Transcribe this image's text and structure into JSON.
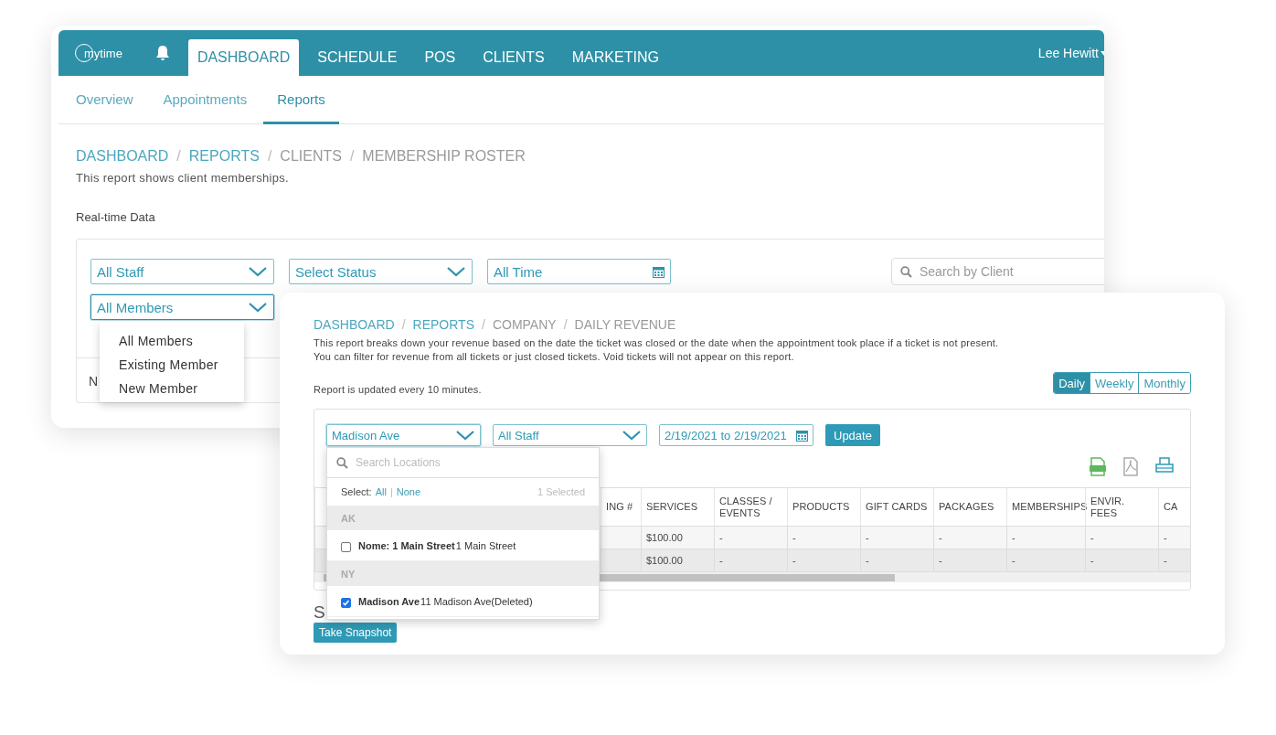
{
  "back_window": {
    "nav": {
      "logo": "mytime",
      "tabs": [
        {
          "label": "DASHBOARD",
          "selected": true
        },
        {
          "label": "SCHEDULE",
          "selected": false
        },
        {
          "label": "POS",
          "selected": false
        },
        {
          "label": "CLIENTS",
          "selected": false
        },
        {
          "label": "MARKETING",
          "selected": false
        }
      ],
      "user": "Lee Hewitt"
    },
    "subnav": [
      {
        "label": "Overview",
        "selected": false
      },
      {
        "label": "Appointments",
        "selected": false
      },
      {
        "label": "Reports",
        "selected": true
      }
    ],
    "breadcrumb": [
      {
        "label": "DASHBOARD",
        "kind": "link"
      },
      {
        "label": "/",
        "kind": "separator"
      },
      {
        "label": "REPORTS",
        "kind": "link"
      },
      {
        "label": "/",
        "kind": "separator"
      },
      {
        "label": "CLIENTS",
        "kind": "text"
      },
      {
        "label": "/",
        "kind": "separator"
      },
      {
        "label": "MEMBERSHIP ROSTER",
        "kind": "text"
      }
    ],
    "description": "This report shows client memberships.",
    "section_title": "Real-time Data",
    "filters": [
      {
        "kind": "select",
        "value": "All Staff"
      },
      {
        "kind": "select",
        "value": "Select Status"
      },
      {
        "kind": "date",
        "value": "All Time"
      }
    ],
    "search": {
      "placeholder": "Search by Client"
    },
    "member_filter": {
      "value": "All Members",
      "expanded": true,
      "options": [
        "All Members",
        "Existing Member",
        "New Member"
      ]
    },
    "footer_text": "N"
  },
  "front_window": {
    "breadcrumb": [
      {
        "label": "DASHBOARD",
        "kind": "link"
      },
      {
        "label": "/",
        "kind": "separator"
      },
      {
        "label": "REPORTS",
        "kind": "link"
      },
      {
        "label": "/",
        "kind": "separator"
      },
      {
        "label": "COMPANY",
        "kind": "text"
      },
      {
        "label": "/",
        "kind": "separator"
      },
      {
        "label": "DAILY REVENUE",
        "kind": "text"
      }
    ],
    "description": "This report breaks down your revenue based on the date the ticket was closed or the date when the appointment took place if a ticket is not present. You can filter for revenue from all tickets or just closed tickets. Void tickets will not appear on this report.",
    "update_note": "Report is updated every 10 minutes.",
    "period_toggle": [
      {
        "label": "Daily",
        "selected": true
      },
      {
        "label": "Weekly",
        "selected": false
      },
      {
        "label": "Monthly",
        "selected": false
      }
    ],
    "filters": [
      {
        "kind": "select",
        "value": "Madison Ave"
      },
      {
        "kind": "select",
        "value": "All Staff"
      },
      {
        "kind": "date",
        "value": "2/19/2021 to 2/19/2021"
      }
    ],
    "update_button": "Update",
    "location_dropdown": {
      "expanded": true,
      "placeholder": "Search Locations",
      "select_label": "Select:",
      "all_link": "All",
      "separator": "|",
      "none_link": "None",
      "count": "1 Selected",
      "groups": [
        {
          "name": "AK",
          "items": [
            {
              "name": "Nome: 1 Main Street",
              "address": "1 Main Street",
              "checked": false
            }
          ]
        },
        {
          "name": "NY",
          "items": [
            {
              "name": "Madison Ave",
              "address": "11 Madison Ave(Deleted)",
              "checked": true
            }
          ]
        }
      ]
    },
    "table": {
      "columns": [
        "ING #",
        "SERVICES",
        "CLASSES / EVENTS",
        "PRODUCTS",
        "GIFT CARDS",
        "PACKAGES",
        "MEMBERSHIPS",
        "ENVIR. FEES",
        "CA"
      ],
      "rows": [
        {
          "cells": [
            "",
            "$100.00",
            "-",
            "-",
            "-",
            "-",
            "-",
            "-",
            "-"
          ]
        },
        {
          "cells": [
            "",
            "$100.00",
            "-",
            "-",
            "-",
            "-",
            "-",
            "-",
            "-"
          ]
        }
      ]
    },
    "snapshot_heading": "S",
    "snapshot_button": "Take Snapshot"
  }
}
